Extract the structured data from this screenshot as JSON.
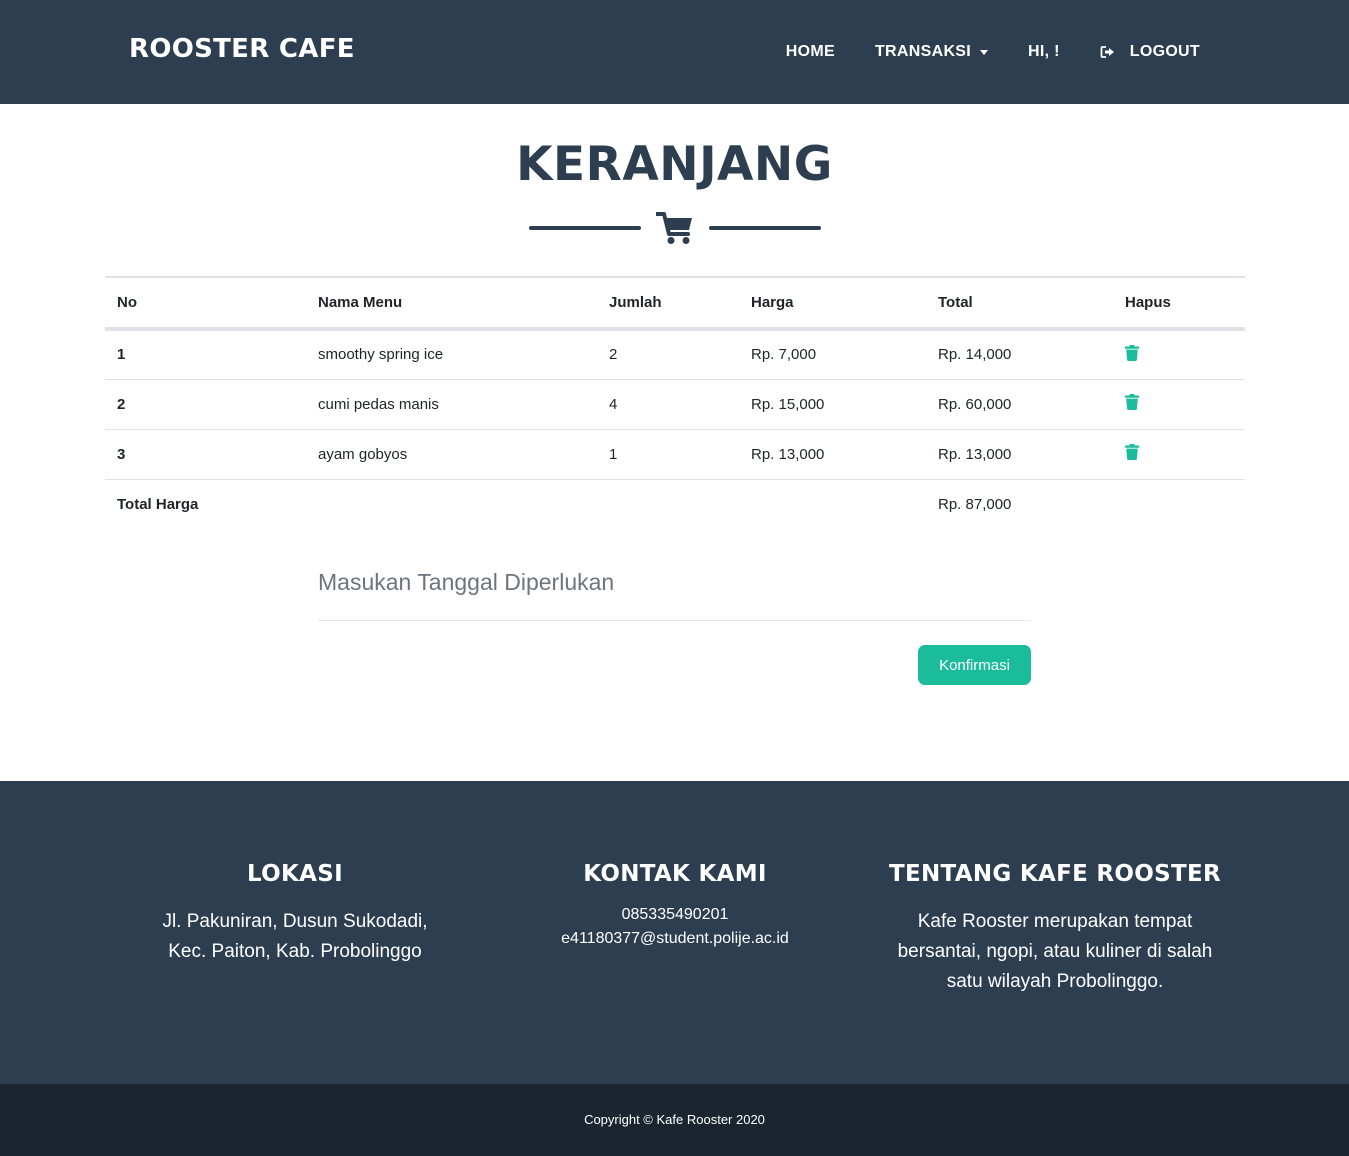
{
  "navbar": {
    "brand": "ROOSTER CAFE",
    "items": [
      {
        "label": "HOME"
      },
      {
        "label": "TRANSAKSI"
      },
      {
        "label": "HI, !"
      },
      {
        "label": "LOGOUT",
        "icon": "sign-out-icon"
      }
    ]
  },
  "page": {
    "title": "KERANJANG",
    "divider_icon": "shopping-cart-icon"
  },
  "table": {
    "headers": [
      "No",
      "Nama Menu",
      "Jumlah",
      "Harga",
      "Total",
      "Hapus"
    ],
    "rows": [
      {
        "no": "1",
        "menu": "smoothy spring ice",
        "jumlah": "2",
        "harga": "Rp. 7,000",
        "total": "Rp. 14,000",
        "action_icon": "trash-icon"
      },
      {
        "no": "2",
        "menu": "cumi pedas manis",
        "jumlah": "4",
        "harga": "Rp. 15,000",
        "total": "Rp. 60,000",
        "action_icon": "trash-icon"
      },
      {
        "no": "3",
        "menu": "ayam gobyos",
        "jumlah": "1",
        "harga": "Rp. 13,000",
        "total": "Rp. 13,000",
        "action_icon": "trash-icon"
      }
    ],
    "total_label": "Total Harga",
    "total_value": "Rp. 87,000"
  },
  "form": {
    "date_placeholder": "Masukan Tanggal Diperlukan",
    "date_value": "",
    "confirm_label": "Konfirmasi"
  },
  "footer": {
    "location": {
      "title": "LOKASI",
      "line1": "Jl. Pakuniran, Dusun Sukodadi,",
      "line2": "Kec. Paiton, Kab. Probolinggo"
    },
    "contact": {
      "title": "KONTAK KAMI",
      "phone": "085335490201",
      "email": "e41180377@student.polije.ac.id"
    },
    "about": {
      "title": "TENTANG KAFE ROOSTER",
      "line1": "Kafe Rooster merupakan tempat",
      "line2": "bersantai, ngopi, atau kuliner di salah",
      "line3": "satu wilayah Probolinggo."
    },
    "copyright": "Copyright © Kafe Rooster 2020"
  },
  "colors": {
    "primary": "#2c3e50",
    "accent": "#1abc9c",
    "footer_dark": "#1a252f"
  }
}
